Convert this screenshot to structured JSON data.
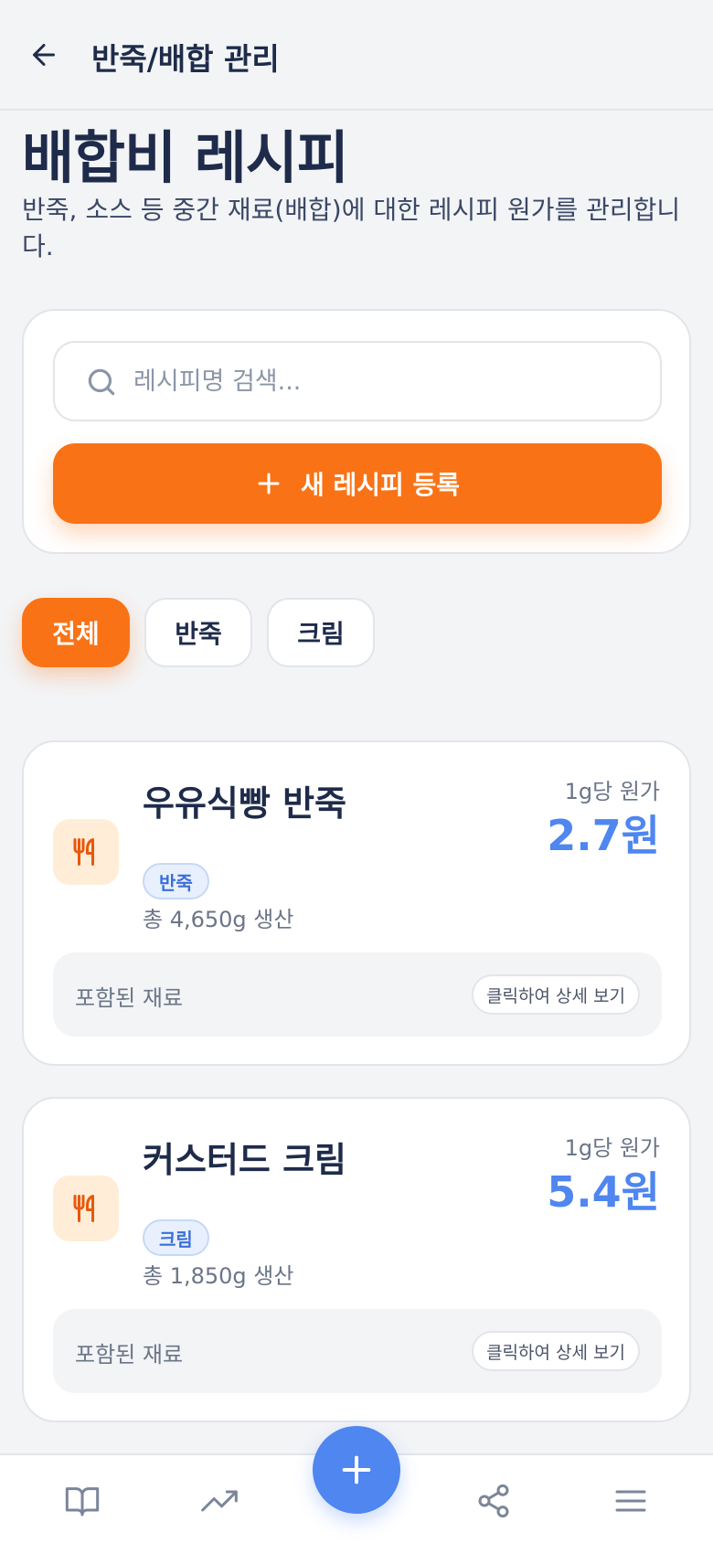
{
  "header": {
    "title": "반죽/배합 관리",
    "back_icon": "arrow-left-icon"
  },
  "page": {
    "title": "배합비 레시피",
    "description": "반죽, 소스 등 중간 재료(배합)에 대한 레시피 원가를 관리합니다."
  },
  "search": {
    "placeholder": "레시피명 검색...",
    "value": "",
    "icon": "search-icon"
  },
  "new_recipe_button": {
    "label": "새 레시피 등록",
    "icon": "plus-icon"
  },
  "filters": [
    {
      "label": "전체",
      "active": true
    },
    {
      "label": "반죽",
      "active": false
    },
    {
      "label": "크림",
      "active": false
    }
  ],
  "recipes": [
    {
      "name": "우유식빵 반죽",
      "tag": "반죽",
      "total": "총 4,650g 생산",
      "unit_label": "1g당 원가",
      "unit_price": "2.7원",
      "ingredients_label": "포함된 재료",
      "detail_label": "클릭하여 상세 보기",
      "icon": "utensils-icon"
    },
    {
      "name": "커스터드 크림",
      "tag": "크림",
      "total": "총 1,850g 생산",
      "unit_label": "1g당 원가",
      "unit_price": "5.4원",
      "ingredients_label": "포함된 재료",
      "detail_label": "클릭하여 상세 보기",
      "icon": "utensils-icon"
    }
  ],
  "bottom_nav": {
    "items": [
      "book-open-icon",
      "trending-up-icon",
      "plus-icon",
      "share-icon",
      "menu-icon"
    ]
  },
  "colors": {
    "accent_orange": "#f97316",
    "accent_blue": "#4f86ef",
    "text_dark": "#1e2b4a",
    "background": "#f3f4f6"
  }
}
